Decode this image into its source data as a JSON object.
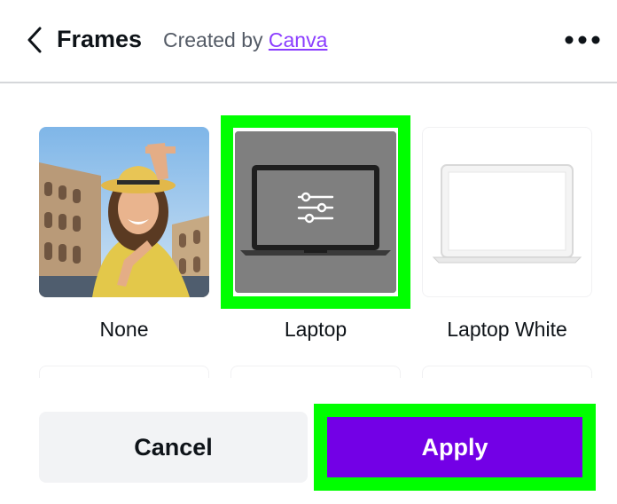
{
  "header": {
    "title": "Frames",
    "created_prefix": "Created by",
    "creator": "Canva",
    "back_icon": "chevron-left-icon",
    "more_icon": "more-horizontal-icon"
  },
  "frames": [
    {
      "label": "None",
      "thumbnail": "photo-woman-framing-hands-at-colosseum"
    },
    {
      "label": "Laptop",
      "thumbnail": "dark-laptop-with-adjust-icon",
      "selected": true
    },
    {
      "label": "Laptop White",
      "thumbnail": "white-laptop"
    }
  ],
  "actions": {
    "cancel_label": "Cancel",
    "apply_label": "Apply"
  },
  "colors": {
    "accent_link": "#8b3dff",
    "apply_bg": "#7300e6",
    "highlight": "#00ff00"
  }
}
